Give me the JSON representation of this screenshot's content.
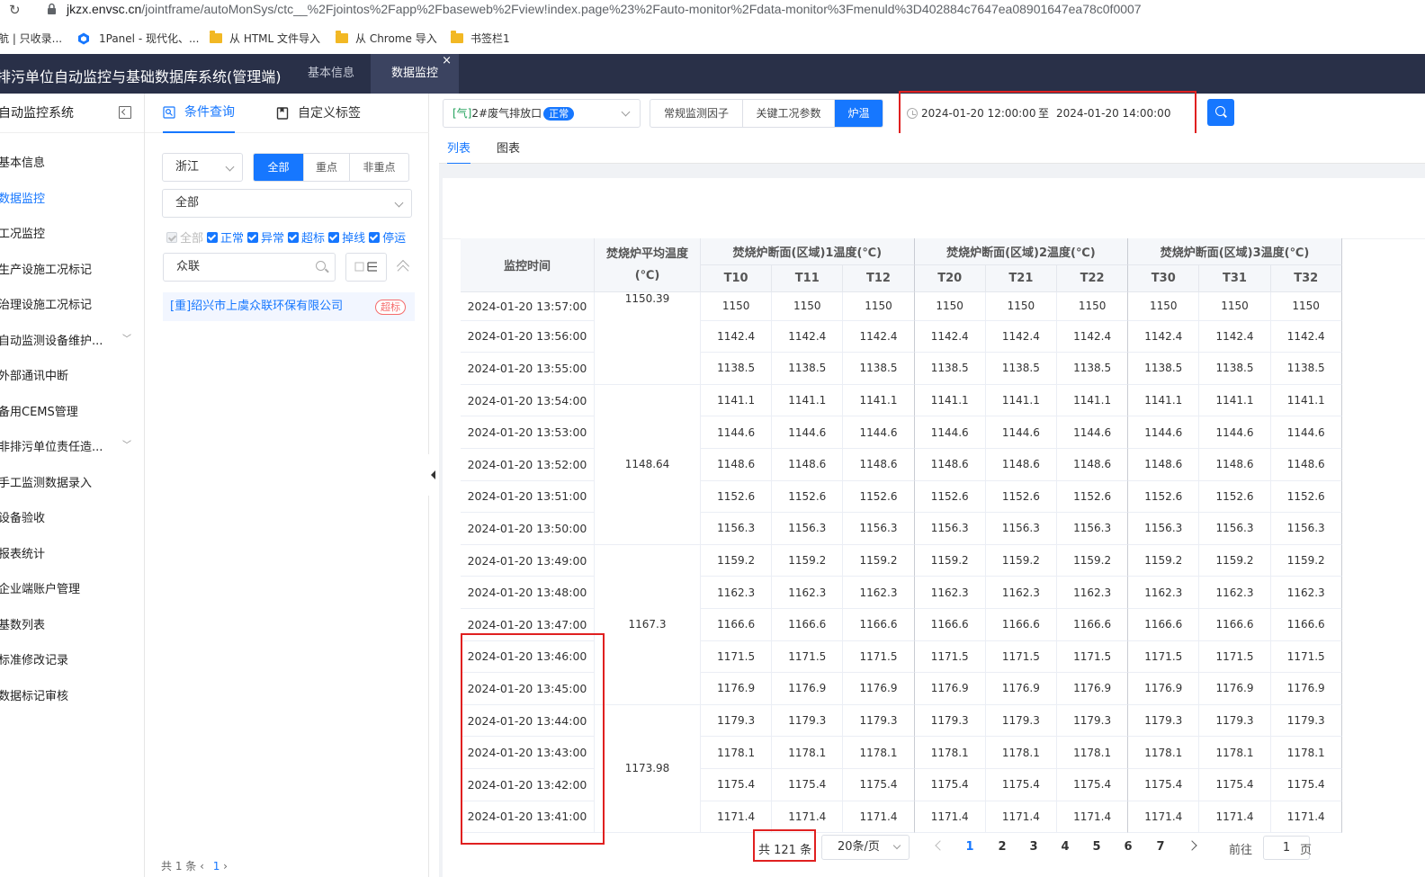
{
  "browser": {
    "url_host": "jkzx.envsc.cn",
    "url_path": "/jointframe/autoMonSys/ctc__%2Fjointos%2Fapp%2Fbaseweb%2Fview!index.page%23%2Fauto-monitor%2Fdata-monitor%3Fmenuld%3D402884c7647ea08901647ea78c0f0007",
    "bookmarks": [
      "航 | 只收录...",
      "1Panel - 现代化、...",
      "从 HTML 文件导入",
      "从 Chrome 导入",
      "书签栏1"
    ]
  },
  "header": {
    "app_title": "重点排污单位自动监控与基础数据库系统(管理端)",
    "tabs": [
      {
        "label": "基本信息",
        "active": false
      },
      {
        "label": "数据监控",
        "active": true,
        "close": "×"
      }
    ]
  },
  "sidebar": {
    "title": "自动监控系统",
    "items": [
      {
        "label": "基本信息",
        "active": false,
        "expandable": false
      },
      {
        "label": "数据监控",
        "active": true,
        "expandable": false
      },
      {
        "label": "工况监控",
        "active": false,
        "expandable": false
      },
      {
        "label": "生产设施工况标记",
        "active": false,
        "expandable": false
      },
      {
        "label": "治理设施工况标记",
        "active": false,
        "expandable": false
      },
      {
        "label": "自动监测设备维护...",
        "active": false,
        "expandable": true
      },
      {
        "label": "外部通讯中断",
        "active": false,
        "expandable": false
      },
      {
        "label": "备用CEMS管理",
        "active": false,
        "expandable": false
      },
      {
        "label": "非排污单位责任造...",
        "active": false,
        "expandable": true
      },
      {
        "label": "手工监测数据录入",
        "active": false,
        "expandable": false
      },
      {
        "label": "设备验收",
        "active": false,
        "expandable": false
      },
      {
        "label": "报表统计",
        "active": false,
        "expandable": false
      },
      {
        "label": "企业端账户管理",
        "active": false,
        "expandable": false
      },
      {
        "label": "基数列表",
        "active": false,
        "expandable": false
      },
      {
        "label": "标准修改记录",
        "active": false,
        "expandable": false
      },
      {
        "label": "数据标记审核",
        "active": false,
        "expandable": false
      }
    ]
  },
  "filter": {
    "tab_query": "条件查询",
    "tab_custom": "自定义标签",
    "province": "浙江",
    "level_options": [
      {
        "label": "全部",
        "on": true
      },
      {
        "label": "重点",
        "on": false
      },
      {
        "label": "非重点",
        "on": false
      }
    ],
    "industry": "全部",
    "status_checks": [
      {
        "label": "全部",
        "disabled": true
      },
      {
        "label": "正常",
        "disabled": false
      },
      {
        "label": "异常",
        "disabled": false
      },
      {
        "label": "超标",
        "disabled": false
      },
      {
        "label": "掉线",
        "disabled": false
      },
      {
        "label": "停运",
        "disabled": false
      }
    ],
    "search_value": "众联",
    "company_name": "[重]绍兴市上虞众联环保有限公司",
    "company_badge": "超标",
    "footer_total": "共 1 条",
    "footer_page": "1"
  },
  "toolbar": {
    "outlet_prefix": "[气]",
    "outlet_name": "2#废气排放口",
    "outlet_status": "正常",
    "factor_tabs": [
      {
        "label": "常规监测因子",
        "on": false
      },
      {
        "label": "关键工况参数",
        "on": false
      },
      {
        "label": "炉温",
        "on": true
      }
    ],
    "date_start": "2024-01-20 12:00:00",
    "date_sep": "至",
    "date_end": "2024-01-20 14:00:00"
  },
  "view_tabs": [
    {
      "label": "列表",
      "active": true
    },
    {
      "label": "图表",
      "active": false
    }
  ],
  "table": {
    "col_time": "监控时间",
    "col_avg": "焚烧炉平均温度(℃)",
    "groups": [
      "焚烧炉断面(区域)1温度(℃)",
      "焚烧炉断面(区域)2温度(℃)",
      "焚烧炉断面(区域)3温度(℃)"
    ],
    "sub_cols": [
      "T10",
      "T11",
      "T12",
      "T20",
      "T21",
      "T22",
      "T30",
      "T31",
      "T32"
    ],
    "rows": [
      {
        "time": "2024-01-20 13:57:00",
        "val": "1150"
      },
      {
        "time": "2024-01-20 13:56:00",
        "val": "1142.4"
      },
      {
        "time": "2024-01-20 13:55:00",
        "val": "1138.5"
      },
      {
        "time": "2024-01-20 13:54:00",
        "val": "1141.1"
      },
      {
        "time": "2024-01-20 13:53:00",
        "val": "1144.6"
      },
      {
        "time": "2024-01-20 13:52:00",
        "val": "1148.6"
      },
      {
        "time": "2024-01-20 13:51:00",
        "val": "1152.6"
      },
      {
        "time": "2024-01-20 13:50:00",
        "val": "1156.3"
      },
      {
        "time": "2024-01-20 13:49:00",
        "val": "1159.2"
      },
      {
        "time": "2024-01-20 13:48:00",
        "val": "1162.3"
      },
      {
        "time": "2024-01-20 13:47:00",
        "val": "1166.6"
      },
      {
        "time": "2024-01-20 13:46:00",
        "val": "1171.5"
      },
      {
        "time": "2024-01-20 13:45:00",
        "val": "1176.9"
      },
      {
        "time": "2024-01-20 13:44:00",
        "val": "1179.3"
      },
      {
        "time": "2024-01-20 13:43:00",
        "val": "1178.1"
      },
      {
        "time": "2024-01-20 13:42:00",
        "val": "1175.4"
      },
      {
        "time": "2024-01-20 13:41:00",
        "val": "1171.4"
      }
    ],
    "avg_groups": [
      {
        "value": "1150.39",
        "rows": 3
      },
      {
        "value": "1148.64",
        "rows": 5
      },
      {
        "value": "1167.3",
        "rows": 5
      },
      {
        "value": "1173.98",
        "rows": 4
      }
    ]
  },
  "pager": {
    "total": "共 121 条",
    "page_size": "20条/页",
    "pages": [
      "1",
      "2",
      "3",
      "4",
      "5",
      "6",
      "7"
    ],
    "current": "1",
    "goto_label": "前往",
    "goto_value": "1",
    "page_label": "页"
  },
  "colors": {
    "accent": "#1677ff",
    "header_bg": "#293048",
    "highlight_red": "#e02020"
  }
}
